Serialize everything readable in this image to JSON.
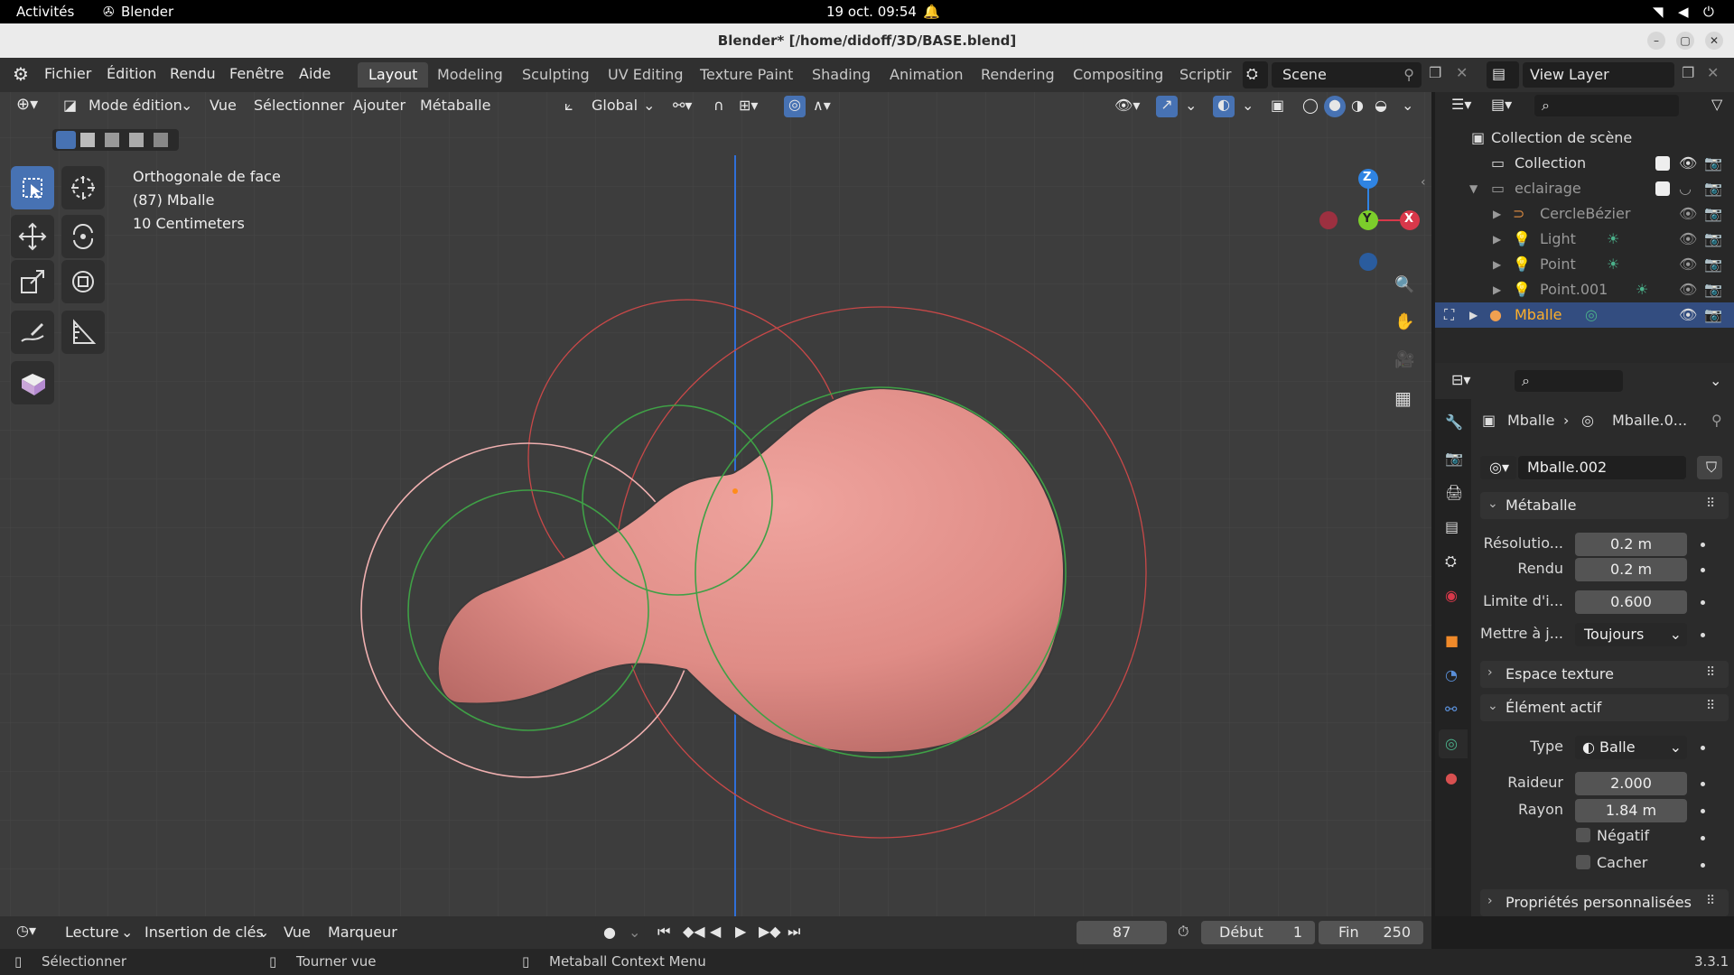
{
  "gnome": {
    "activities": "Activités",
    "app": "Blender",
    "clock": "19 oct.  09:54"
  },
  "window": {
    "title": "Blender* [/home/didoff/3D/BASE.blend]"
  },
  "menubar": {
    "menus": [
      "Fichier",
      "Édition",
      "Rendu",
      "Fenêtre",
      "Aide"
    ],
    "workspaces": [
      "Layout",
      "Modeling",
      "Sculpting",
      "UV Editing",
      "Texture Paint",
      "Shading",
      "Animation",
      "Rendering",
      "Compositing",
      "Scriptir"
    ],
    "active_workspace": "Layout",
    "scene": "Scene",
    "view_layer": "View Layer"
  },
  "viewport_header": {
    "mode": "Mode édition",
    "menus": [
      "Vue",
      "Sélectionner",
      "Ajouter",
      "Métaballe"
    ],
    "orientation": "Global"
  },
  "viewport_info": {
    "line1": "Orthogonale de face",
    "line2": "(87) Mballe",
    "line3": "10 Centimeters"
  },
  "gizmo": {
    "z": "Z",
    "y": "Y",
    "x": "X"
  },
  "colors": {
    "accent": "#4772b3",
    "metaball": "#e0908a",
    "selected_text": "#ffaf29",
    "axis_x": "#d8384a",
    "axis_y": "#7ccd2b",
    "axis_z": "#2f84e3"
  },
  "timeline": {
    "menus": [
      "Lecture",
      "Insertion de clés",
      "Vue",
      "Marqueur"
    ],
    "current_frame": "87",
    "start_label": "Début",
    "start": "1",
    "end_label": "Fin",
    "end": "250"
  },
  "statusbar": {
    "left": "Sélectionner",
    "middle": "Tourner vue",
    "right": "Metaball Context Menu",
    "version": "3.3.1"
  },
  "outliner": {
    "scene_collection": "Collection de scène",
    "items": [
      {
        "label": "Collection",
        "icon": "collection-icon"
      },
      {
        "label": "eclairage",
        "icon": "collection-icon"
      },
      {
        "label": "CercleBézier",
        "icon": "curve-icon"
      },
      {
        "label": "Light",
        "icon": "light-icon"
      },
      {
        "label": "Point",
        "icon": "light-icon"
      },
      {
        "label": "Point.001",
        "icon": "light-icon"
      },
      {
        "label": "Mballe",
        "icon": "metaball-icon"
      }
    ]
  },
  "properties": {
    "breadcrumb_object": "Mballe",
    "breadcrumb_data": "Mballe.0...",
    "datablock": "Mballe.002",
    "panel_metaball": "Métaballe",
    "resolution_label": "Résolutio...",
    "resolution": "0.2 m",
    "render_label": "Rendu",
    "render": "0.2 m",
    "threshold_label": "Limite d'i...",
    "threshold": "0.600",
    "update_label": "Mettre à j...",
    "update": "Toujours",
    "panel_texture": "Espace texture",
    "panel_active": "Élément actif",
    "type_label": "Type",
    "type": "Balle",
    "stiffness_label": "Raideur",
    "stiffness": "2.000",
    "radius_label": "Rayon",
    "radius": "1.84 m",
    "negative_label": "Négatif",
    "hide_label": "Cacher",
    "panel_custom": "Propriétés personnalisées"
  }
}
